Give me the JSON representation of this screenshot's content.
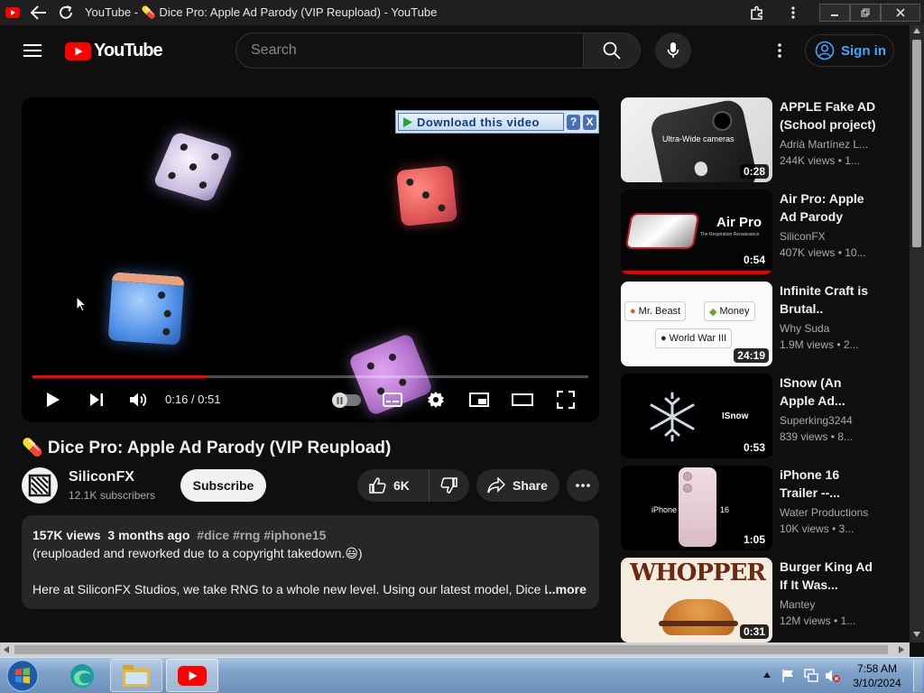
{
  "browser": {
    "window_title": "YouTube - 💊 Dice Pro: Apple Ad Parody (VIP Reupload) - YouTube"
  },
  "masthead": {
    "logo_text": "YouTube",
    "search_placeholder": "Search",
    "sign_in_label": "Sign in"
  },
  "player": {
    "download_banner_label": "Download this video",
    "download_help": "?",
    "download_close": "X",
    "time_display": "0:16 / 0:51",
    "progress_fraction": 0.314
  },
  "video": {
    "title": "💊 Dice Pro: Apple Ad Parody (VIP Reupload)",
    "channel_name": "SiliconFX",
    "subscribers": "12.1K subscribers",
    "subscribe_label": "Subscribe",
    "likes": "6K",
    "share_label": "Share"
  },
  "description": {
    "views": "157K views",
    "age": "3 months ago",
    "tags": "#dice #rng #iphone15",
    "line2": "(reuploaded and reworked due to a copyright takedown.😃)",
    "line3": "Here at SiliconFX Studios, we take RNG to a whole new level. Using our latest model, Dice P",
    "more_label": "...more"
  },
  "recommendations": [
    {
      "title_line1": "APPLE Fake AD",
      "title_line2": "(School project)",
      "channel": "Adrià Martínez L...",
      "stats": "244K views  • 1...",
      "duration": "0:28",
      "thumb_text": "Ultra-Wide cameras"
    },
    {
      "title_line1": "Air Pro: Apple",
      "title_line2": "Ad Parody",
      "channel": "SiliconFX",
      "stats": "407K views  • 10...",
      "duration": "0:54",
      "thumb_text": "Air Pro",
      "thumb_subtext": "The Respiration Renaissance",
      "watched": true
    },
    {
      "title_line1": "Infinite Craft is",
      "title_line2": "Brutal..",
      "channel": "Why Suda",
      "stats": "1.9M views  • 2...",
      "duration": "24:19",
      "chips": [
        "Mr. Beast",
        "Money",
        "World War III"
      ]
    },
    {
      "title_line1": "ISnow (An",
      "title_line2": "Apple Ad...",
      "channel": "Superking3244",
      "stats": "839 views  • 8...",
      "duration": "0:53",
      "thumb_text": "ISnow"
    },
    {
      "title_line1": "iPhone 16",
      "title_line2": "Trailer --...",
      "channel": "Water Productions",
      "stats": "10K views  • 3...",
      "duration": "1:05",
      "thumb_text_left": "iPhone",
      "thumb_text_right": "16"
    },
    {
      "title_line1": "Burger King Ad",
      "title_line2": "If It Was...",
      "channel": "Mantey",
      "stats": "12M views  • 1...",
      "duration": "0:31",
      "thumb_text": "WHOPPER"
    }
  ],
  "taskbar": {
    "time": "7:58 AM",
    "date": "3/10/2024"
  },
  "colors": {
    "accent_red": "#ff0000",
    "link_blue": "#3ea6ff",
    "background": "#0f0f0f"
  }
}
